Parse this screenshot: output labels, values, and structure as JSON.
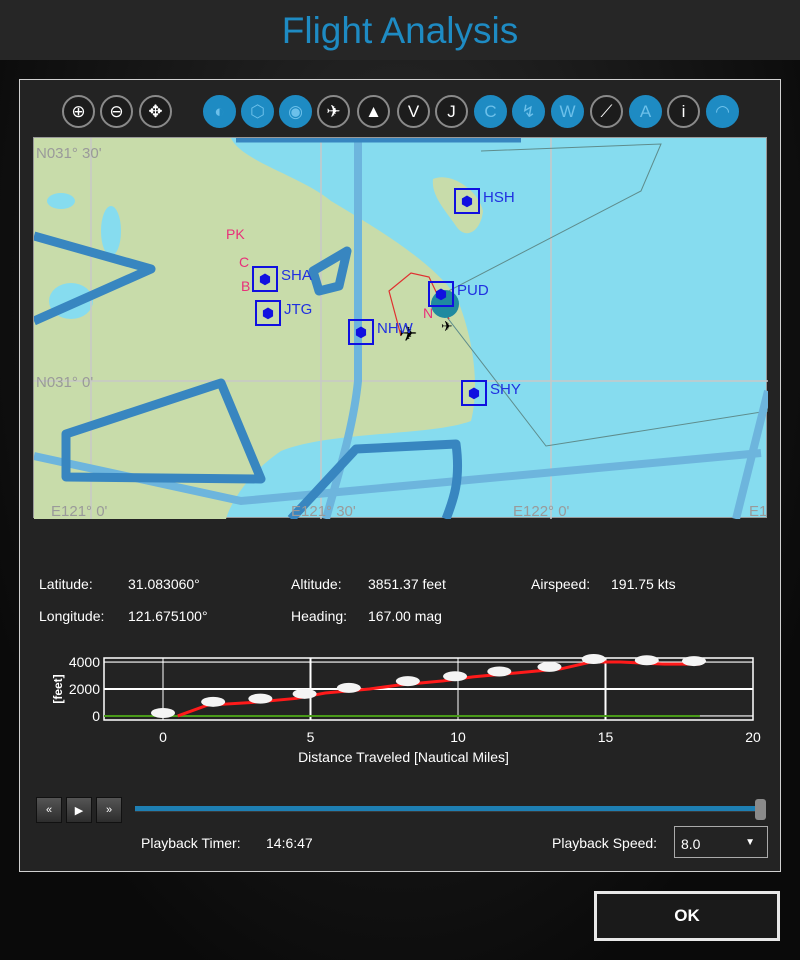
{
  "title": "Flight Analysis",
  "toolbar": [
    {
      "icon": "zoom-in-icon",
      "glyph": "⊕",
      "active": false
    },
    {
      "icon": "zoom-out-icon",
      "glyph": "⊖",
      "active": false
    },
    {
      "icon": "pan-center-icon",
      "glyph": "✥",
      "active": false
    },
    {
      "icon": "runway-icon",
      "glyph": "◐",
      "active": true
    },
    {
      "icon": "vor-icon",
      "glyph": "⬡",
      "active": true
    },
    {
      "icon": "ndb-icon",
      "glyph": "◉",
      "active": true
    },
    {
      "icon": "airplane-icon",
      "glyph": "✈",
      "active": false
    },
    {
      "icon": "waypoint-triangle-icon",
      "glyph": "▲",
      "active": false
    },
    {
      "icon": "victor-airway-icon",
      "glyph": "V",
      "active": false
    },
    {
      "icon": "jet-airway-icon",
      "glyph": "J",
      "active": false
    },
    {
      "icon": "class-c-icon",
      "glyph": "C",
      "active": true
    },
    {
      "icon": "route-icon",
      "glyph": "↯",
      "active": true
    },
    {
      "icon": "weather-icon",
      "glyph": "W",
      "active": true
    },
    {
      "icon": "flight-path-icon",
      "glyph": "⟋",
      "active": false
    },
    {
      "icon": "airport-a-icon",
      "glyph": "A",
      "active": true
    },
    {
      "icon": "info-icon",
      "glyph": "i",
      "active": false
    },
    {
      "icon": "terrain-icon",
      "glyph": "◠",
      "active": true
    }
  ],
  "map": {
    "grid_labels": [
      "N031° 30'",
      "N031° 0'",
      "E121° 0'",
      "E121° 30'",
      "E122° 0'",
      "E1"
    ],
    "navaids": [
      "HSH",
      "SHA",
      "JTG",
      "NHW",
      "PUD",
      "SHY"
    ],
    "fixes": [
      "PK",
      "C",
      "B",
      "N"
    ]
  },
  "flight": {
    "latitude_label": "Latitude:",
    "latitude": "31.083060°",
    "longitude_label": "Longitude:",
    "longitude": "121.675100°",
    "altitude_label": "Altitude:",
    "altitude": "3851.37 feet",
    "heading_label": "Heading:",
    "heading": "167.00 mag",
    "airspeed_label": "Airspeed:",
    "airspeed": "191.75 kts"
  },
  "chart_data": {
    "type": "line",
    "xlabel": "Distance Traveled [Nautical Miles]",
    "ylabel": "[feet]",
    "xlim": [
      -2,
      20
    ],
    "ylim": [
      -300,
      4300
    ],
    "xticks": [
      0,
      5,
      10,
      15,
      20
    ],
    "yticks": [
      0,
      2000,
      4000
    ],
    "grid": true,
    "series": [
      {
        "color": "#ff1a1a",
        "x": [
          0.5,
          1.5,
          3,
          4.5,
          5.5,
          7,
          8,
          9.5,
          10.5,
          12,
          13.5,
          14.5,
          15.5,
          17,
          18.2
        ],
        "y": [
          0,
          800,
          1000,
          1300,
          1700,
          2000,
          2300,
          2600,
          2900,
          3200,
          3500,
          4000,
          4000,
          3850,
          3850
        ]
      },
      {
        "color": "#4a9a1a",
        "x": [
          -2,
          18.2
        ],
        "y": [
          0,
          0
        ]
      }
    ],
    "marker_x": [
      0,
      1.7,
      3.3,
      4.8,
      6.3,
      8.3,
      9.9,
      11.4,
      13.1,
      14.6,
      16.4,
      18
    ]
  },
  "playback": {
    "rewind": "«",
    "play": "▶",
    "forward": "»",
    "progress": 1.0,
    "timer_label": "Playback Timer:",
    "timer": "14:6:47",
    "speed_label": "Playback Speed:",
    "speed": "8.0"
  },
  "ok_label": "OK"
}
